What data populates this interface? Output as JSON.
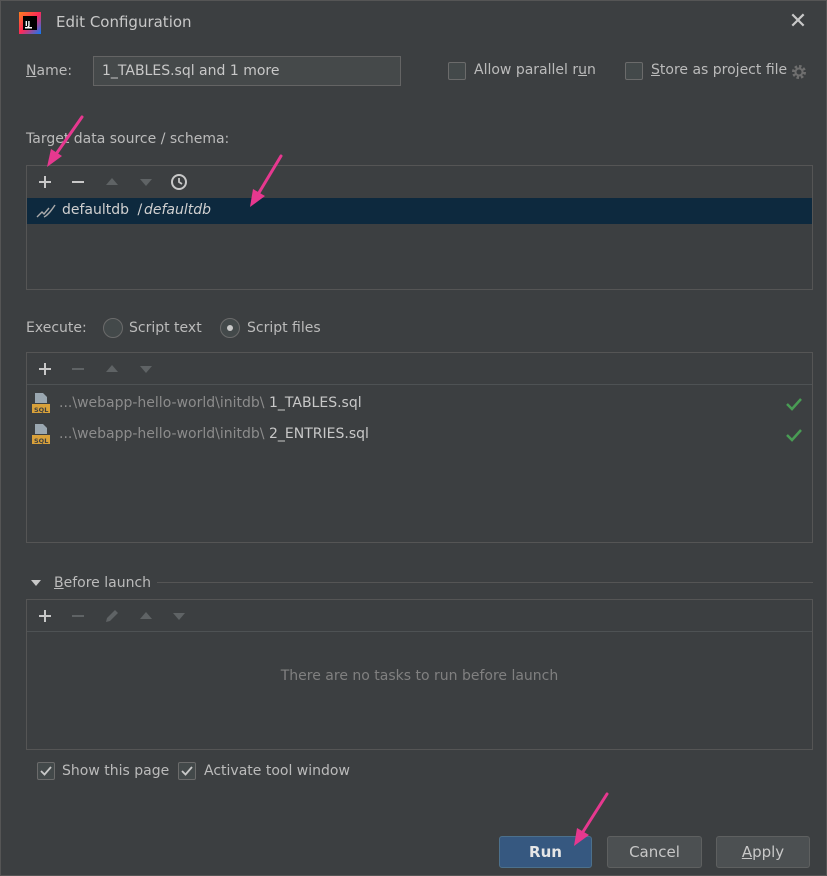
{
  "window": {
    "title": "Edit Configuration",
    "close_label": "✕"
  },
  "name": {
    "label": "Name:",
    "label_mnemonic": "N",
    "label_rest": "ame:",
    "value": "1_TABLES.sql and 1 more"
  },
  "options": {
    "allow_parallel": {
      "label_pre": "Allow parallel r",
      "label_mnemonic": "u",
      "label_post": "n",
      "checked": false
    },
    "store_project": {
      "label_pre": "",
      "label_mnemonic": "S",
      "label_post": "tore as project file",
      "checked": false
    }
  },
  "target": {
    "label": "Target data source / schema:",
    "rows": [
      {
        "db": "defaultdb",
        "sep": " / ",
        "schema": "defaultdb"
      }
    ]
  },
  "execute": {
    "label": "Execute:",
    "script_text_label": "Script text",
    "script_files_label": "Script files",
    "selected": "Script files",
    "files": [
      {
        "dim": "...\\webapp-hello-world\\initdb\\",
        "name": "1_TABLES.sql",
        "icon": "sql-file-icon"
      },
      {
        "dim": "...\\webapp-hello-world\\initdb\\",
        "name": "2_ENTRIES.sql",
        "icon": "sql-file-icon"
      }
    ]
  },
  "before_launch": {
    "label_mnemonic": "B",
    "label_rest": "efore launch",
    "empty_text": "There are no tasks to run before launch"
  },
  "footer_options": {
    "show_page": {
      "label": "Show this page",
      "checked": true
    },
    "activate_tool": {
      "label": "Activate tool window",
      "checked": true
    }
  },
  "buttons": {
    "run": "Run",
    "cancel": "Cancel",
    "apply_mnemonic": "A",
    "apply_rest": "pply"
  },
  "colors": {
    "annotation_arrow": "#e6388f",
    "selection": "#0d293e",
    "primary_button": "#365880",
    "check_green": "#499c54"
  }
}
